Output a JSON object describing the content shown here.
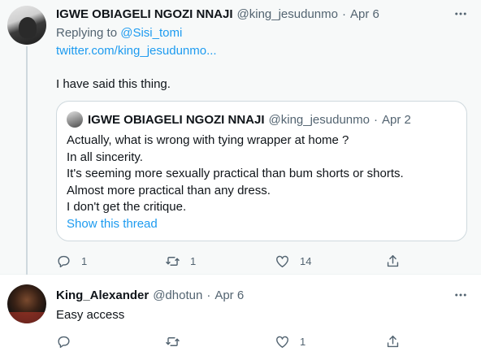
{
  "tweet1": {
    "display_name": "IGWE OBIAGELI NGOZI NNAJI",
    "handle": "@king_jesudunmo",
    "separator": "·",
    "date": "Apr 6",
    "replying_prefix": "Replying to",
    "replying_handle": "@Sisi_tomi",
    "link_text": "twitter.com/king_jesudunmo...",
    "text": "I have said this thing.",
    "quote": {
      "display_name": "IGWE OBIAGELI NGOZI NNAJI",
      "handle": "@king_jesudunmo",
      "separator": "·",
      "date": "Apr 2",
      "lines": [
        "Actually, what is wrong with tying wrapper at home ?",
        "In all sincerity.",
        "It's seeming more sexually practical than bum shorts or shorts.",
        "Almost more practical than any dress.",
        "I don't get the critique."
      ],
      "show_thread": "Show this thread"
    },
    "actions": {
      "replies": "1",
      "retweets": "1",
      "likes": "14"
    }
  },
  "tweet2": {
    "display_name": "King_Alexander",
    "handle": "@dhotun",
    "separator": "·",
    "date": "Apr 6",
    "text": "Easy access",
    "actions": {
      "replies": "",
      "retweets": "",
      "likes": "1"
    }
  },
  "icons": {
    "reply": "reply-icon",
    "retweet": "retweet-icon",
    "like": "heart-icon",
    "share": "share-icon",
    "more": "more-icon"
  },
  "colors": {
    "link": "#1d9bf0",
    "muted": "#536471",
    "text": "#0f1419",
    "thread_bg": "#f7f9f9",
    "thread_line": "#cfd9de"
  }
}
